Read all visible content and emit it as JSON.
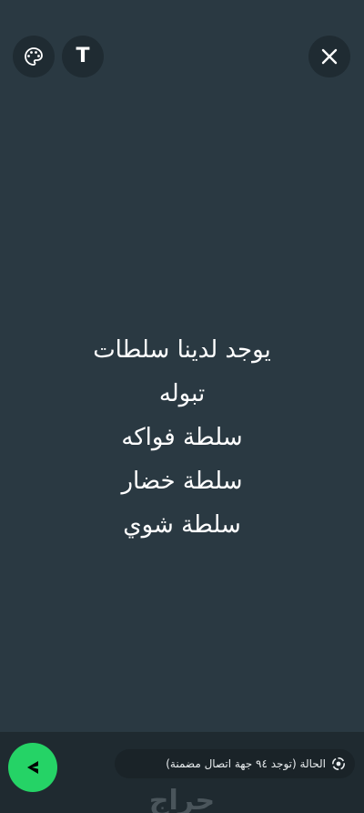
{
  "toolbar": {
    "palette_icon": "palette-icon",
    "text_icon_label": "T",
    "close_icon": "close-icon"
  },
  "status": {
    "lines": [
      "يوجد لدينا سلطات",
      "تبوله",
      "سلطة فواكه",
      "سلطة خضار",
      "سلطة شوي"
    ],
    "background_color": "#2a3942"
  },
  "footer": {
    "privacy_label": "الحالة (توجد ٩٤ جهة اتصال مضمنة)",
    "privacy_icon": "status-privacy-icon",
    "send_icon": "send-icon",
    "send_color": "#25d366"
  },
  "watermark": {
    "text": "حراج"
  }
}
